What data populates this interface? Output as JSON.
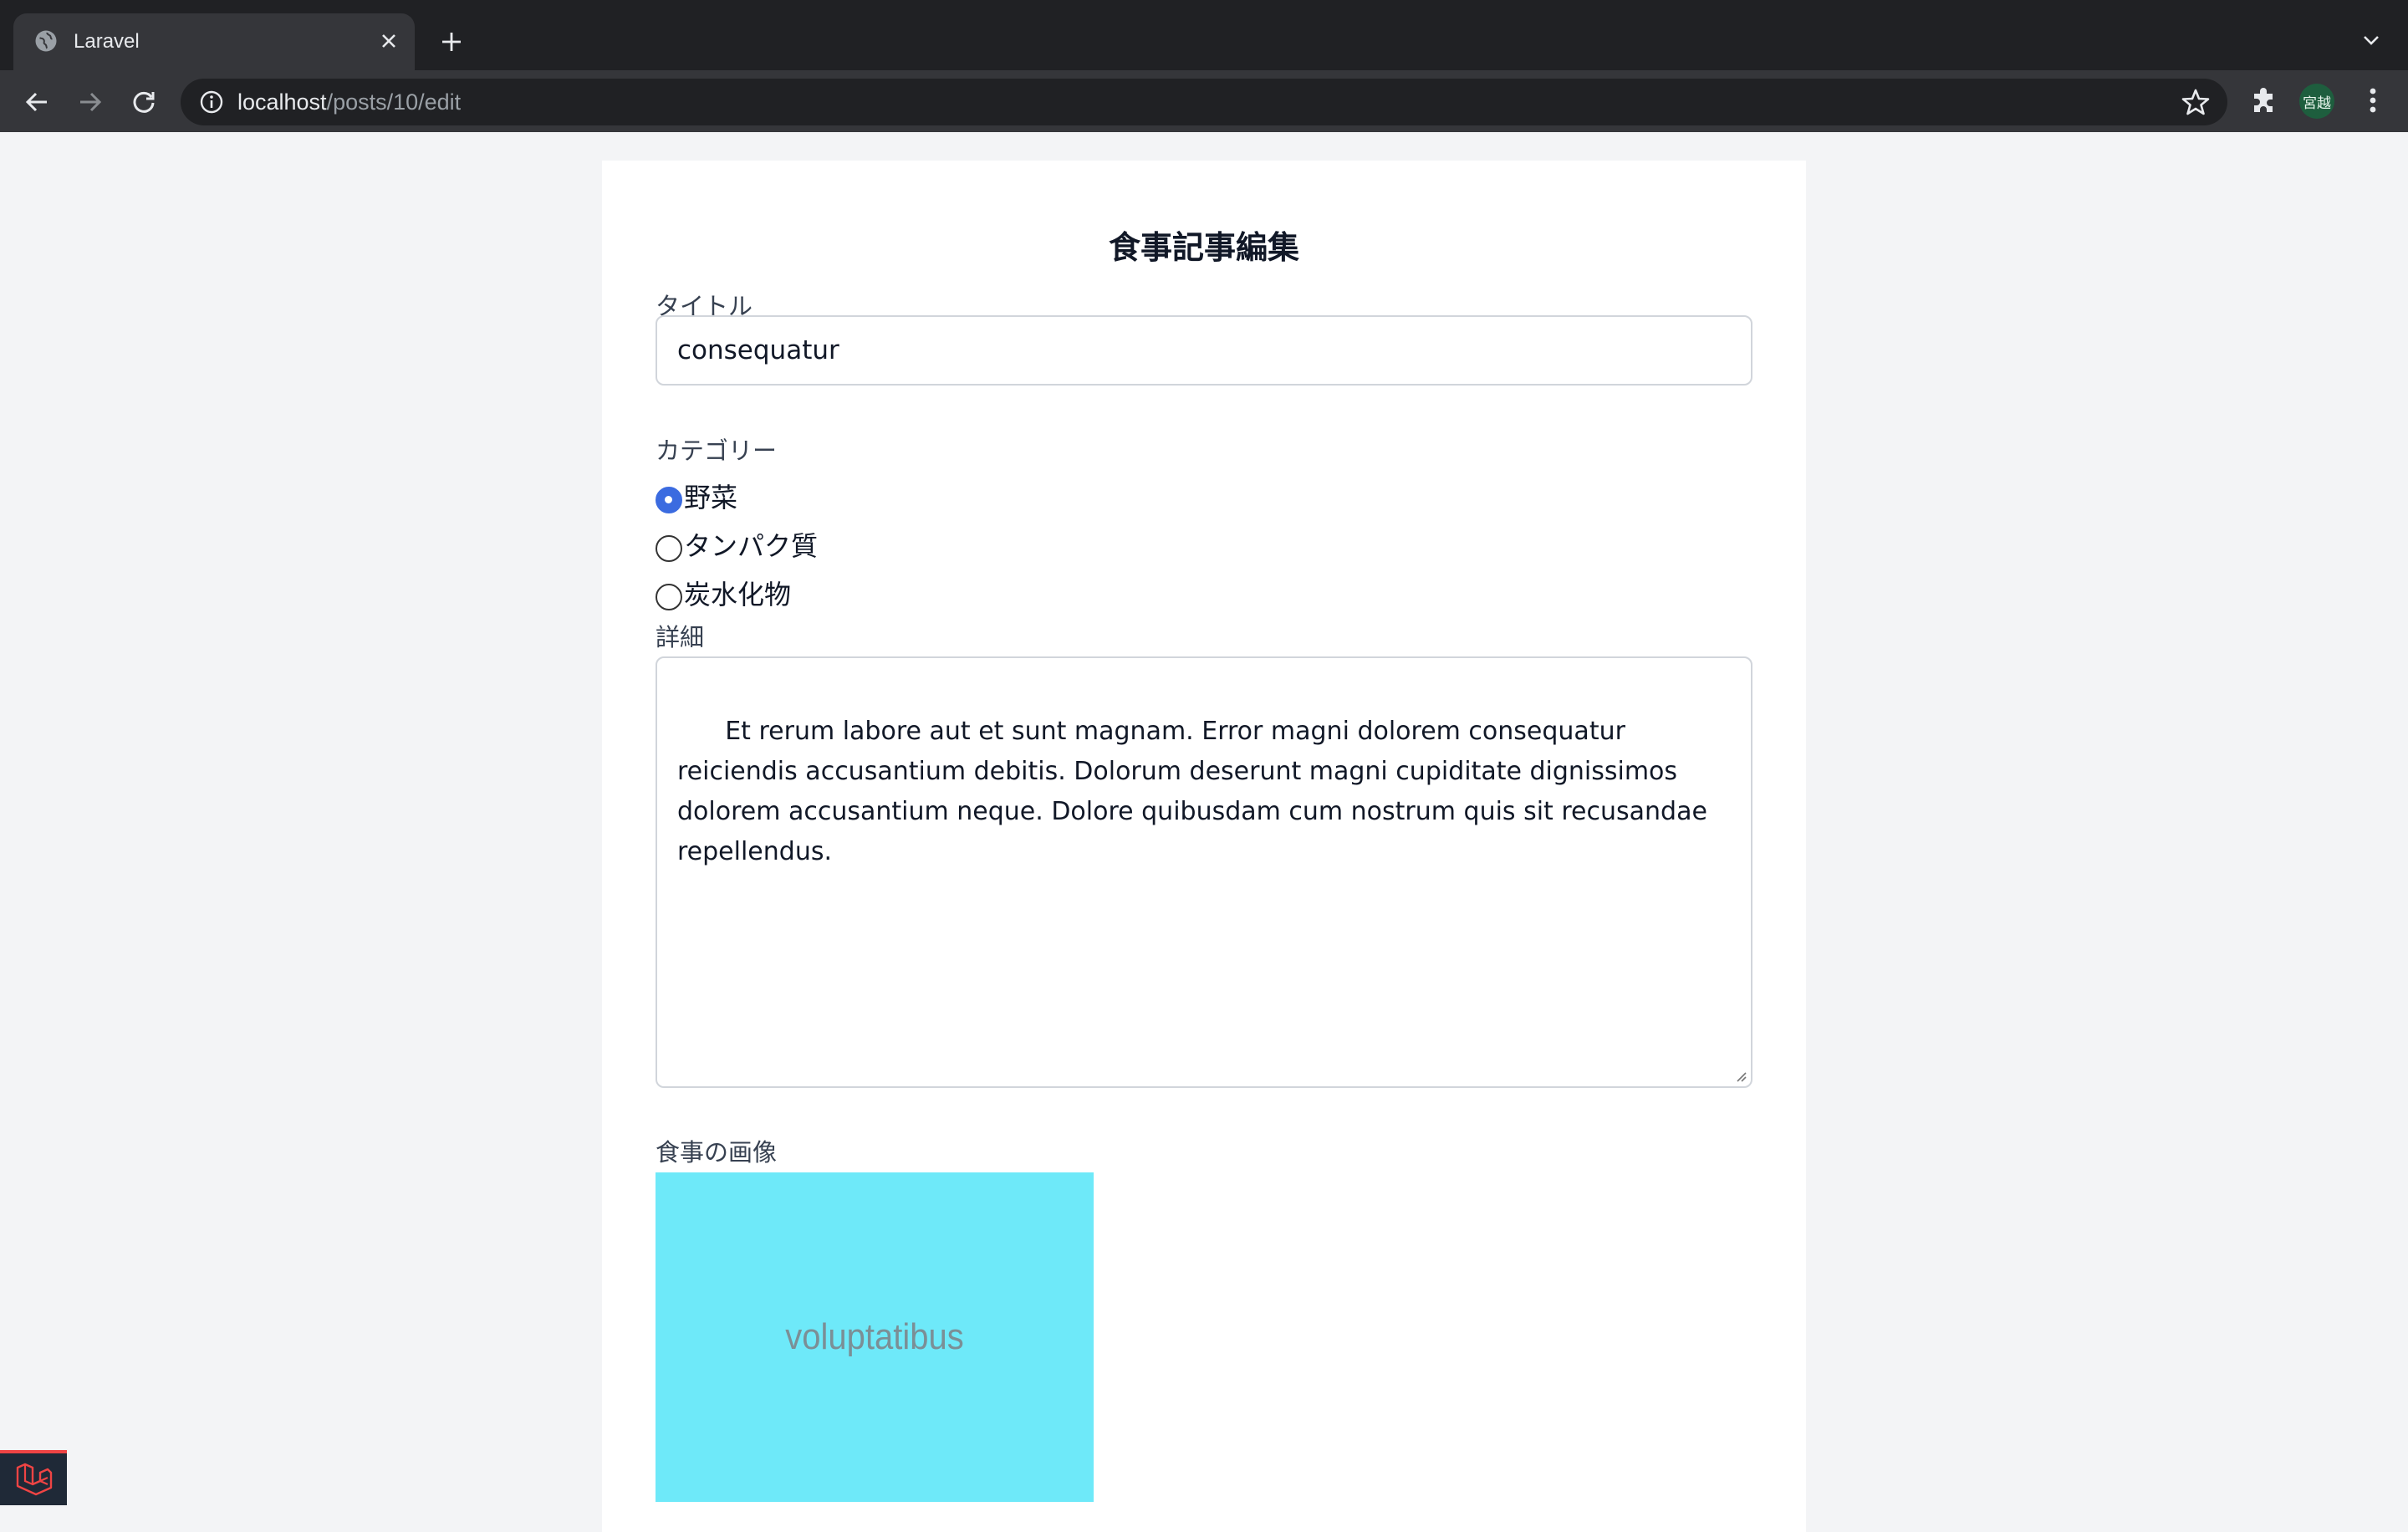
{
  "browser": {
    "tab_title": "Laravel",
    "url_host": "localhost",
    "url_path": "/posts/10/edit",
    "profile_initials": "宮越"
  },
  "form": {
    "heading": "食事記事編集",
    "title_label": "タイトル",
    "title_value": "consequatur",
    "category_label": "カテゴリー",
    "categories": [
      {
        "label": "野菜",
        "checked": true
      },
      {
        "label": "タンパク質",
        "checked": false
      },
      {
        "label": "炭水化物",
        "checked": false
      }
    ],
    "detail_label": "詳細",
    "detail_value": "Et rerum labore aut et sunt magnam. Error magni dolorem consequatur reiciendis accusantium debitis. Dolorum deserunt magni cupiditate dignissimos dolorem accusantium neque. Dolore quibusdam cum nostrum quis sit recusandae repellendus.",
    "image_label": "食事の画像",
    "image_placeholder_text": "voluptatibus"
  },
  "colors": {
    "accent_radio": "#3b6be0",
    "image_placeholder_bg": "#6ee9f9",
    "laravel_red": "#ef4444"
  },
  "icons": [
    "globe-icon",
    "close-icon",
    "plus-icon",
    "chevron-down-icon",
    "back-arrow-icon",
    "forward-arrow-icon",
    "reload-icon",
    "info-icon",
    "star-icon",
    "puzzle-icon",
    "more-vert-icon",
    "laravel-logo-icon"
  ]
}
